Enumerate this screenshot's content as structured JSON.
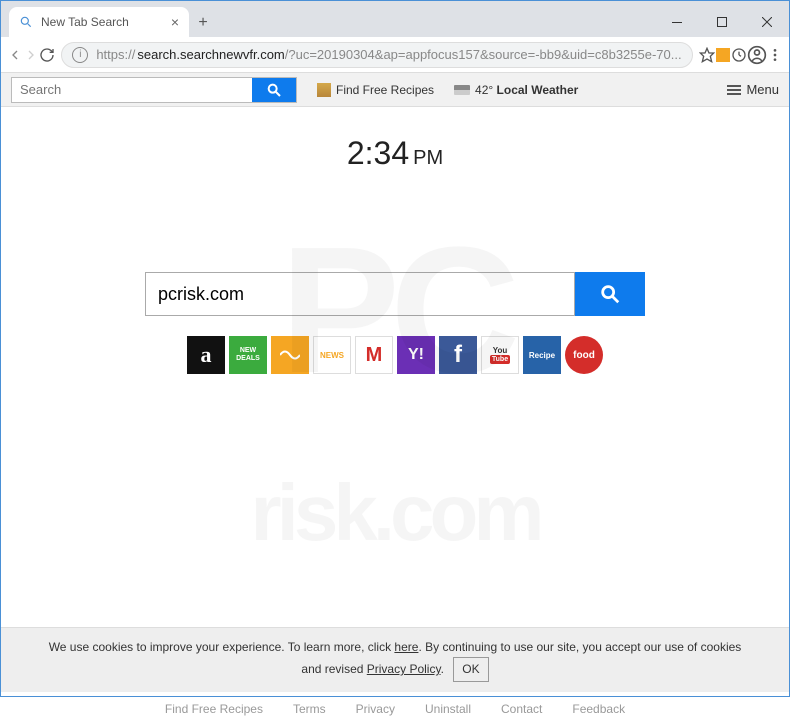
{
  "tab": {
    "title": "New Tab Search"
  },
  "url": {
    "prefix": "https://",
    "host": "search.searchnewvfr.com",
    "rest": "/?uc=20190304&ap=appfocus157&source=-bb9&uid=c8b3255e-70..."
  },
  "toolbar": {
    "search_placeholder": "Search",
    "recipes": "Find Free Recipes",
    "weather_temp": "42°",
    "weather_label": "Local Weather",
    "menu": "Menu"
  },
  "clock": {
    "time": "2:34",
    "ampm": "PM"
  },
  "main_search": {
    "value": "pcrisk.com"
  },
  "tiles": [
    {
      "name": "amazon",
      "bg": "#111",
      "label": "a"
    },
    {
      "name": "new-deals",
      "bg": "#3bab3e",
      "label": "NEW DEALS"
    },
    {
      "name": "audible",
      "bg": "#f5a623",
      "label": ""
    },
    {
      "name": "news",
      "bg": "#fff",
      "label": "NEWS"
    },
    {
      "name": "gmail",
      "bg": "#fff",
      "label": "M"
    },
    {
      "name": "yahoo",
      "bg": "#6b2fb5",
      "label": "Y!"
    },
    {
      "name": "facebook",
      "bg": "#3b5998",
      "label": "f"
    },
    {
      "name": "youtube",
      "bg": "#fff",
      "label": "You"
    },
    {
      "name": "recipe",
      "bg": "#2763a8",
      "label": "Recipe"
    },
    {
      "name": "food",
      "bg": "#d42d2a",
      "label": "food"
    }
  ],
  "cookie": {
    "text1": "We use cookies to improve your experience. To learn more, click ",
    "here": "here",
    "text2": ". By continuing to use our site, you accept our use of cookies and revised ",
    "privacy": "Privacy Policy",
    "dot": ".",
    "ok": "OK"
  },
  "footer": {
    "recipes": "Find Free Recipes",
    "terms": "Terms",
    "privacy": "Privacy",
    "uninstall": "Uninstall",
    "contact": "Contact",
    "feedback": "Feedback"
  }
}
